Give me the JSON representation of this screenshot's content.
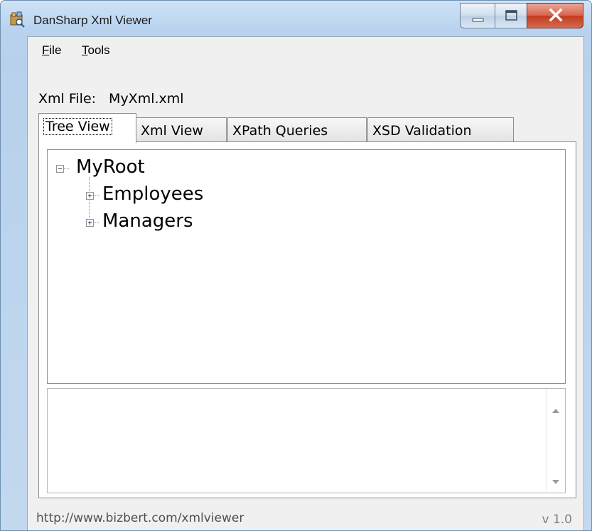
{
  "window": {
    "title": "DanSharp Xml Viewer",
    "app_icon": "xml-viewer-app-icon",
    "caption_buttons": [
      "minimize-icon",
      "maximize-icon",
      "close-icon"
    ]
  },
  "menu": {
    "items": [
      {
        "accel": "F",
        "rest": "ile"
      },
      {
        "accel": "T",
        "rest": "ools"
      }
    ]
  },
  "file": {
    "label": "Xml File:",
    "name": "MyXml.xml"
  },
  "tabs": [
    {
      "label": "Tree View",
      "active": true
    },
    {
      "label": "Xml View",
      "active": false
    },
    {
      "label": "XPath Queries",
      "active": false
    },
    {
      "label": "XSD Validation",
      "active": false
    }
  ],
  "tree": {
    "root": {
      "label": "MyRoot",
      "state": "expanded"
    },
    "children": [
      {
        "label": "Employees",
        "state": "collapsed"
      },
      {
        "label": "Managers",
        "state": "collapsed"
      }
    ]
  },
  "details": {
    "text": ""
  },
  "status": {
    "url": "http://www.bizbert.com/xmlviewer",
    "version": "v 1.0"
  },
  "colors": {
    "frame": "#b9d3ee",
    "close_button": "#c33a1f",
    "client": "#f0f0f0"
  }
}
